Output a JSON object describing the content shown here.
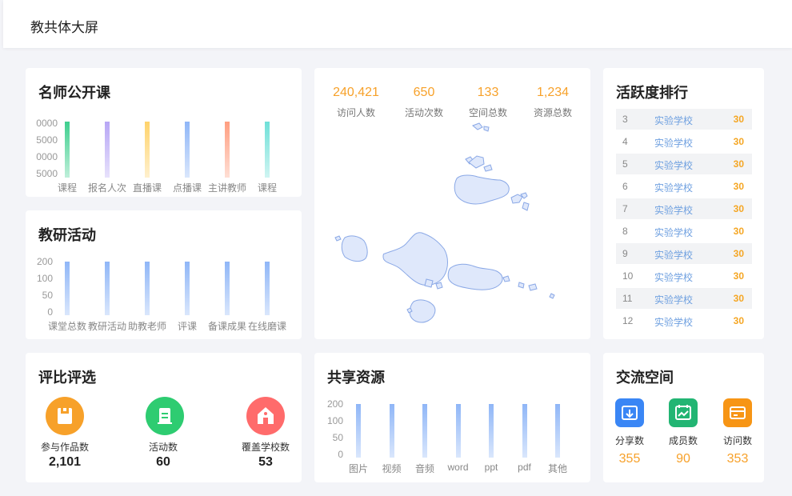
{
  "header": {
    "title": "教共体大屏"
  },
  "famous_courses": {
    "title": "名师公开课",
    "chart_data": {
      "type": "bar",
      "categories": [
        "课程",
        "报名人次",
        "直播课",
        "点播课",
        "主讲教师",
        "课程"
      ],
      "values": [
        19000,
        19000,
        19000,
        19000,
        19000,
        19000
      ],
      "ytick_labels": [
        "0000",
        "5000",
        "0000",
        "5000"
      ],
      "colors": [
        "#3ecf8e",
        "#b7a6f5",
        "#ffd36b",
        "#8fb6f7",
        "#ff9e80",
        "#6fe0d8"
      ]
    }
  },
  "research": {
    "title": "教研活动",
    "chart_data": {
      "type": "bar",
      "categories": [
        "课堂总数",
        "教研活动",
        "助教老师",
        "评课",
        "备课成果",
        "在线磨课"
      ],
      "values": [
        190,
        190,
        190,
        190,
        190,
        190
      ],
      "ytick_labels": [
        "200",
        "100",
        "50",
        "0"
      ],
      "ylim": [
        0,
        200
      ],
      "color": "#8fb6f7"
    }
  },
  "stats": [
    {
      "value": "240,421",
      "label": "访问人数"
    },
    {
      "value": "650",
      "label": "活动次数"
    },
    {
      "value": "133",
      "label": "空间总数"
    },
    {
      "value": "1,234",
      "label": "资源总数"
    }
  ],
  "ranking": {
    "title": "活跃度排行",
    "rows": [
      {
        "rank": "3",
        "name": "实验学校",
        "value": "30"
      },
      {
        "rank": "4",
        "name": "实验学校",
        "value": "30"
      },
      {
        "rank": "5",
        "name": "实验学校",
        "value": "30"
      },
      {
        "rank": "6",
        "name": "实验学校",
        "value": "30"
      },
      {
        "rank": "7",
        "name": "实验学校",
        "value": "30"
      },
      {
        "rank": "8",
        "name": "实验学校",
        "value": "30"
      },
      {
        "rank": "9",
        "name": "实验学校",
        "value": "30"
      },
      {
        "rank": "10",
        "name": "实验学校",
        "value": "30"
      },
      {
        "rank": "11",
        "name": "实验学校",
        "value": "30"
      },
      {
        "rank": "12",
        "name": "实验学校",
        "value": "30"
      }
    ]
  },
  "evaluation": {
    "title": "评比评选",
    "items": [
      {
        "label": "参与作品数",
        "value": "2,101",
        "color": "#f7a12a",
        "icon": "box-icon"
      },
      {
        "label": "活动数",
        "value": "60",
        "color": "#2ecc71",
        "icon": "document-icon"
      },
      {
        "label": "覆盖学校数",
        "value": "53",
        "color": "#ff6b6b",
        "icon": "school-icon"
      }
    ]
  },
  "shared_resources": {
    "title": "共享资源",
    "chart_data": {
      "type": "bar",
      "categories": [
        "图片",
        "视频",
        "音频",
        "word",
        "ppt",
        "pdf",
        "其他"
      ],
      "values": [
        190,
        190,
        190,
        190,
        190,
        190,
        190
      ],
      "ytick_labels": [
        "200",
        "100",
        "50",
        "0"
      ],
      "ylim": [
        0,
        200
      ],
      "color": "#8fb6f7"
    }
  },
  "exchange": {
    "title": "交流空间",
    "items": [
      {
        "label": "分享数",
        "value": "355",
        "color": "#3a86f5",
        "icon": "share-icon"
      },
      {
        "label": "成员数",
        "value": "90",
        "color": "#22b573",
        "icon": "calendar-chart-icon"
      },
      {
        "label": "访问数",
        "value": "353",
        "color": "#f79515",
        "icon": "card-icon"
      }
    ]
  }
}
